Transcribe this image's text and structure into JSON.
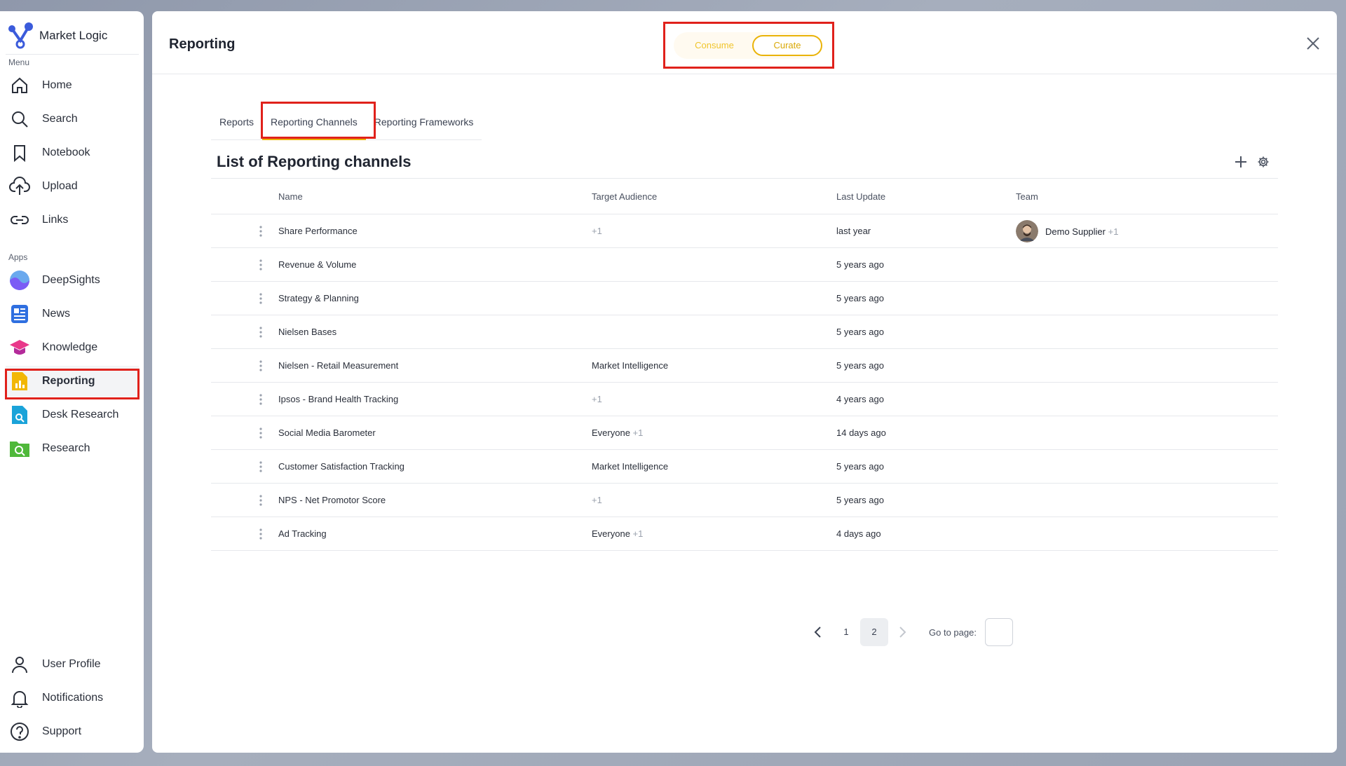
{
  "brand": {
    "name": "Market Logic"
  },
  "sidebar": {
    "menu_label": "Menu",
    "apps_label": "Apps",
    "menu": [
      {
        "label": "Home",
        "icon": "home-icon"
      },
      {
        "label": "Search",
        "icon": "search-icon"
      },
      {
        "label": "Notebook",
        "icon": "bookmark-icon"
      },
      {
        "label": "Upload",
        "icon": "upload-icon"
      },
      {
        "label": "Links",
        "icon": "link-icon"
      }
    ],
    "apps": [
      {
        "label": "DeepSights",
        "icon": "deepsights-icon"
      },
      {
        "label": "News",
        "icon": "news-icon"
      },
      {
        "label": "Knowledge",
        "icon": "knowledge-icon"
      },
      {
        "label": "Reporting",
        "icon": "reporting-icon",
        "active": true
      },
      {
        "label": "Desk Research",
        "icon": "desk-research-icon"
      },
      {
        "label": "Research",
        "icon": "research-icon"
      }
    ],
    "bottom": [
      {
        "label": "User Profile",
        "icon": "user-icon"
      },
      {
        "label": "Notifications",
        "icon": "bell-icon"
      },
      {
        "label": "Support",
        "icon": "help-icon"
      }
    ]
  },
  "header": {
    "title": "Reporting",
    "toggle": {
      "consume": "Consume",
      "curate": "Curate",
      "selected": "Curate"
    }
  },
  "tabs": [
    {
      "label": "Reports"
    },
    {
      "label": "Reporting Channels",
      "active": true
    },
    {
      "label": "Reporting Frameworks"
    }
  ],
  "list": {
    "title": "List of Reporting channels",
    "columns": {
      "name": "Name",
      "audience": "Target Audience",
      "updated": "Last Update",
      "team": "Team"
    },
    "rows": [
      {
        "name": "Share Performance",
        "audience": "",
        "audience_extra": "+1",
        "updated": "last year",
        "team": "Demo Supplier",
        "team_extra": "+1"
      },
      {
        "name": "Revenue & Volume",
        "audience": "",
        "audience_extra": "",
        "updated": "5 years ago",
        "team": "",
        "team_extra": ""
      },
      {
        "name": "Strategy & Planning",
        "audience": "",
        "audience_extra": "",
        "updated": "5 years ago",
        "team": "",
        "team_extra": ""
      },
      {
        "name": "Nielsen Bases",
        "audience": "",
        "audience_extra": "",
        "updated": "5 years ago",
        "team": "",
        "team_extra": ""
      },
      {
        "name": "Nielsen - Retail Measurement",
        "audience": "Market Intelligence",
        "audience_extra": "",
        "updated": "5 years ago",
        "team": "",
        "team_extra": ""
      },
      {
        "name": "Ipsos - Brand Health Tracking",
        "audience": "",
        "audience_extra": "+1",
        "updated": "4 years ago",
        "team": "",
        "team_extra": ""
      },
      {
        "name": "Social Media Barometer",
        "audience": "Everyone",
        "audience_extra": "+1",
        "updated": "14 days ago",
        "team": "",
        "team_extra": ""
      },
      {
        "name": "Customer Satisfaction Tracking",
        "audience": "Market Intelligence",
        "audience_extra": "",
        "updated": "5 years ago",
        "team": "",
        "team_extra": ""
      },
      {
        "name": "NPS - Net Promotor Score",
        "audience": "",
        "audience_extra": "+1",
        "updated": "5 years ago",
        "team": "",
        "team_extra": ""
      },
      {
        "name": "Ad Tracking",
        "audience": "Everyone",
        "audience_extra": "+1",
        "updated": "4 days ago",
        "team": "",
        "team_extra": ""
      }
    ]
  },
  "pagination": {
    "pages": [
      "1",
      "2"
    ],
    "current": "2",
    "goto_label": "Go to page:",
    "goto_value": ""
  },
  "colors": {
    "accent": "#eab308",
    "highlight": "#e0211b",
    "brand": "#3b5bdb"
  }
}
